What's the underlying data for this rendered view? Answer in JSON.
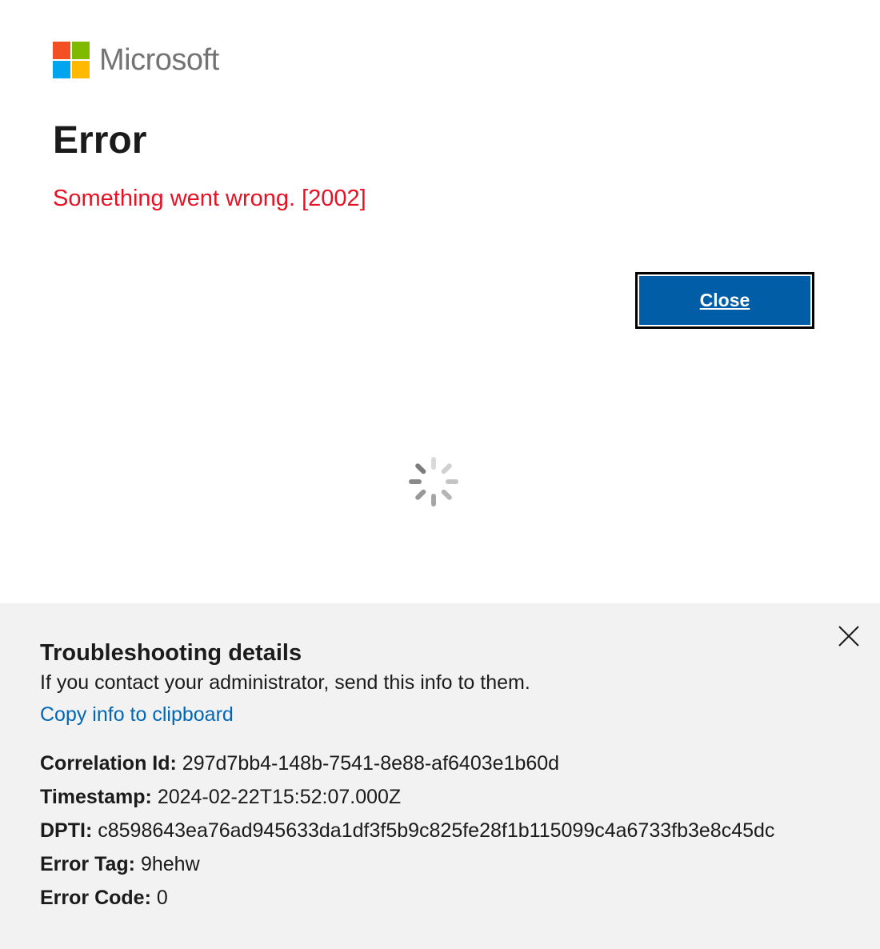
{
  "brand": {
    "name": "Microsoft",
    "colors": [
      "#f25022",
      "#7fba00",
      "#00a4ef",
      "#ffb900"
    ]
  },
  "main": {
    "title": "Error",
    "message": "Something went wrong. [2002]",
    "close_label": "Close",
    "loading_icon": "spinner-icon"
  },
  "troubleshooting": {
    "title": "Troubleshooting details",
    "subtitle": "If you contact your administrator, send this info to them.",
    "copy_label": "Copy info to clipboard",
    "close_icon": "close-icon",
    "details": [
      {
        "label": "Correlation Id:",
        "value": "297d7bb4-148b-7541-8e88-af6403e1b60d"
      },
      {
        "label": "Timestamp:",
        "value": "2024-02-22T15:52:07.000Z"
      },
      {
        "label": "DPTI:",
        "value": "c8598643ea76ad945633da1df3f5b9c825fe28f1b115099c4a6733fb3e8c45dc"
      },
      {
        "label": "Error Tag:",
        "value": "9hehw"
      },
      {
        "label": "Error Code:",
        "value": "0"
      }
    ]
  },
  "colors": {
    "error": "#e81123",
    "button": "#005da6",
    "link": "#0067b8",
    "panel": "#f2f2f2"
  }
}
